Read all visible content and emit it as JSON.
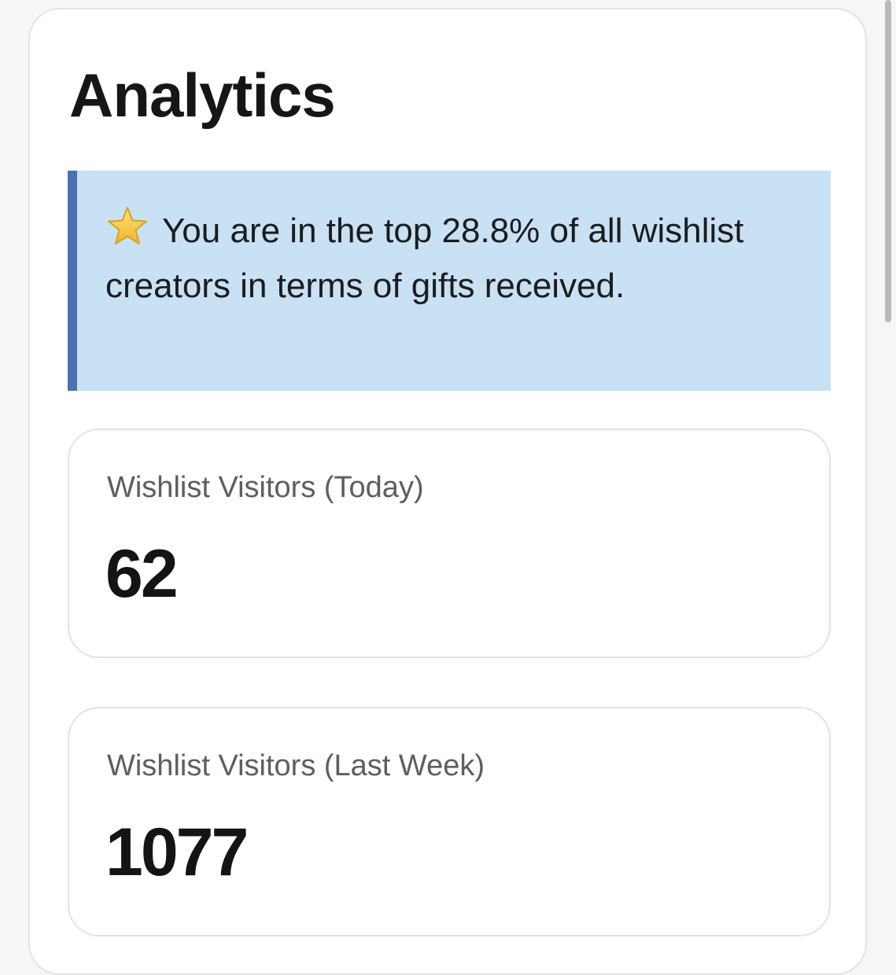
{
  "analytics": {
    "title": "Analytics",
    "notice": {
      "icon": "star-icon",
      "text": "You are in the top 28.8% of all wishlist creators in terms of gifts received."
    },
    "stats": [
      {
        "label": "Wishlist Visitors (Today)",
        "value": "62"
      },
      {
        "label": "Wishlist Visitors (Last Week)",
        "value": "1077"
      }
    ]
  },
  "colors": {
    "notice_background": "#c8e1f5",
    "notice_accent": "#4a72b0",
    "star": "#f5c83b"
  }
}
